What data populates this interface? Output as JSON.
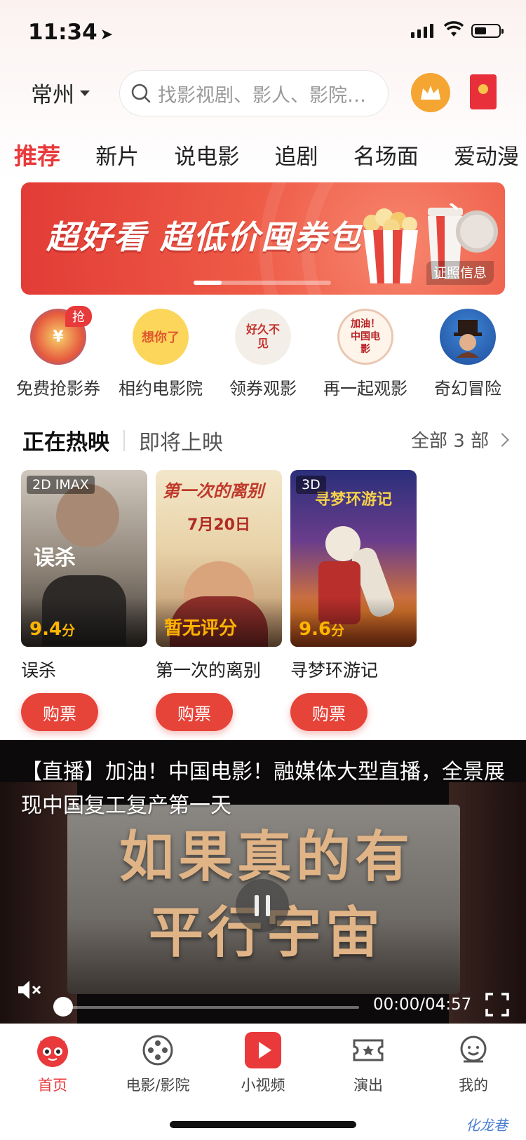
{
  "status": {
    "time": "11:34"
  },
  "header": {
    "city": "常州",
    "search_placeholder": "找影视剧、影人、影院、..."
  },
  "tabs": [
    "推荐",
    "新片",
    "说电影",
    "追剧",
    "名场面",
    "爱动漫"
  ],
  "banner": {
    "text": "超好看 超低价囤券包",
    "license": "证照信息"
  },
  "quick": [
    {
      "label": "免费抢影券",
      "badge": "抢"
    },
    {
      "label": "相约电影院",
      "icon_text": "想你了"
    },
    {
      "label": "领券观影",
      "icon_text": "好久不见"
    },
    {
      "label": "再一起观影",
      "icon_text": "加油！中国电影"
    },
    {
      "label": "奇幻冒险"
    }
  ],
  "section": {
    "now": "正在热映",
    "soon": "即将上映",
    "all": "全部 3 部"
  },
  "movies": [
    {
      "title": "误杀",
      "tag": "2D IMAX",
      "score": "9.4",
      "unit": "分",
      "buy": "购票",
      "poster_text": "误杀"
    },
    {
      "title": "第一次的离别",
      "tag": "",
      "score": "暂无评分",
      "unit": "",
      "buy": "购票",
      "poster_text": "第一次的离别",
      "poster_date": "7月20日"
    },
    {
      "title": "寻梦环游记",
      "tag": "3D",
      "score": "9.6",
      "unit": "分",
      "buy": "购票",
      "poster_text": "寻梦环游记"
    }
  ],
  "video": {
    "title": "【直播】加油！中国电影！融媒体大型直播，全景展现中国复工复产第一天",
    "line1": "如果真的有",
    "line2": "平行宇宙",
    "time": "00:00/04:57",
    "progress": 0
  },
  "nav": [
    {
      "label": "首页",
      "active": true
    },
    {
      "label": "电影/影院"
    },
    {
      "label": "小视频"
    },
    {
      "label": "演出"
    },
    {
      "label": "我的"
    }
  ],
  "watermark": "化龙巷",
  "colors": {
    "accent": "#e9393b",
    "score": "#ffb400"
  }
}
